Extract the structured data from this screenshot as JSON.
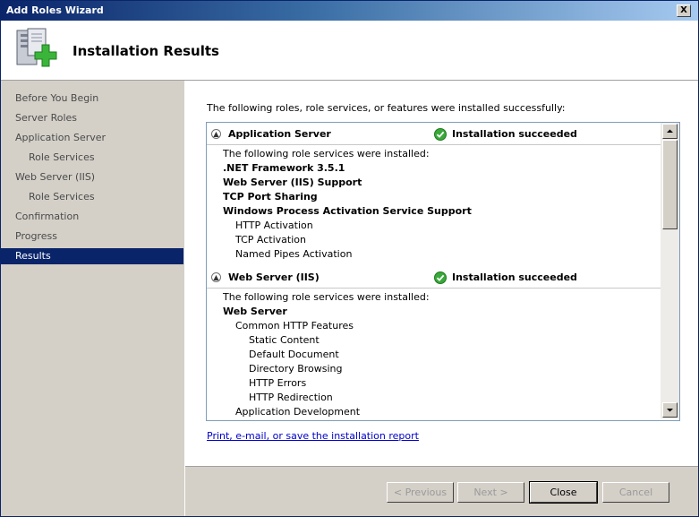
{
  "window": {
    "title": "Add Roles Wizard",
    "close_label": "X"
  },
  "header": {
    "title": "Installation Results",
    "icon": "server-roles-add-icon"
  },
  "nav": {
    "items": [
      {
        "label": "Before You Begin",
        "level": 0
      },
      {
        "label": "Server Roles",
        "level": 0
      },
      {
        "label": "Application Server",
        "level": 0
      },
      {
        "label": "Role Services",
        "level": 1
      },
      {
        "label": "Web Server (IIS)",
        "level": 0
      },
      {
        "label": "Role Services",
        "level": 1
      },
      {
        "label": "Confirmation",
        "level": 0
      },
      {
        "label": "Progress",
        "level": 0
      },
      {
        "label": "Results",
        "level": 0,
        "active": true
      }
    ]
  },
  "main": {
    "intro": "The following roles, role services, or features were installed successfully:",
    "sections": [
      {
        "role": "Application Server",
        "status": "Installation succeeded",
        "installed_label": "The following role services were installed:",
        "items": [
          {
            "text": ".NET Framework 3.5.1",
            "bold": true,
            "indent": 0
          },
          {
            "text": "Web Server (IIS) Support",
            "bold": true,
            "indent": 0
          },
          {
            "text": "TCP Port Sharing",
            "bold": true,
            "indent": 0
          },
          {
            "text": "Windows Process Activation Service Support",
            "bold": true,
            "indent": 0
          },
          {
            "text": "HTTP Activation",
            "bold": false,
            "indent": 1
          },
          {
            "text": "TCP Activation",
            "bold": false,
            "indent": 1
          },
          {
            "text": "Named Pipes Activation",
            "bold": false,
            "indent": 1
          }
        ]
      },
      {
        "role": "Web Server (IIS)",
        "status": "Installation succeeded",
        "installed_label": "The following role services were installed:",
        "items": [
          {
            "text": "Web Server",
            "bold": true,
            "indent": 0
          },
          {
            "text": "Common HTTP Features",
            "bold": false,
            "indent": 1
          },
          {
            "text": "Static Content",
            "bold": false,
            "indent": 2
          },
          {
            "text": "Default Document",
            "bold": false,
            "indent": 2
          },
          {
            "text": "Directory Browsing",
            "bold": false,
            "indent": 2
          },
          {
            "text": "HTTP Errors",
            "bold": false,
            "indent": 2
          },
          {
            "text": "HTTP Redirection",
            "bold": false,
            "indent": 2
          },
          {
            "text": "Application Development",
            "bold": false,
            "indent": 1
          }
        ]
      }
    ],
    "print_link": "Print, e-mail, or save the installation report"
  },
  "buttons": {
    "previous": "< Previous",
    "next": "Next >",
    "close": "Close",
    "cancel": "Cancel"
  },
  "colors": {
    "selection": "#0a246a",
    "success": "#3aa83a",
    "link": "#0000cc"
  }
}
